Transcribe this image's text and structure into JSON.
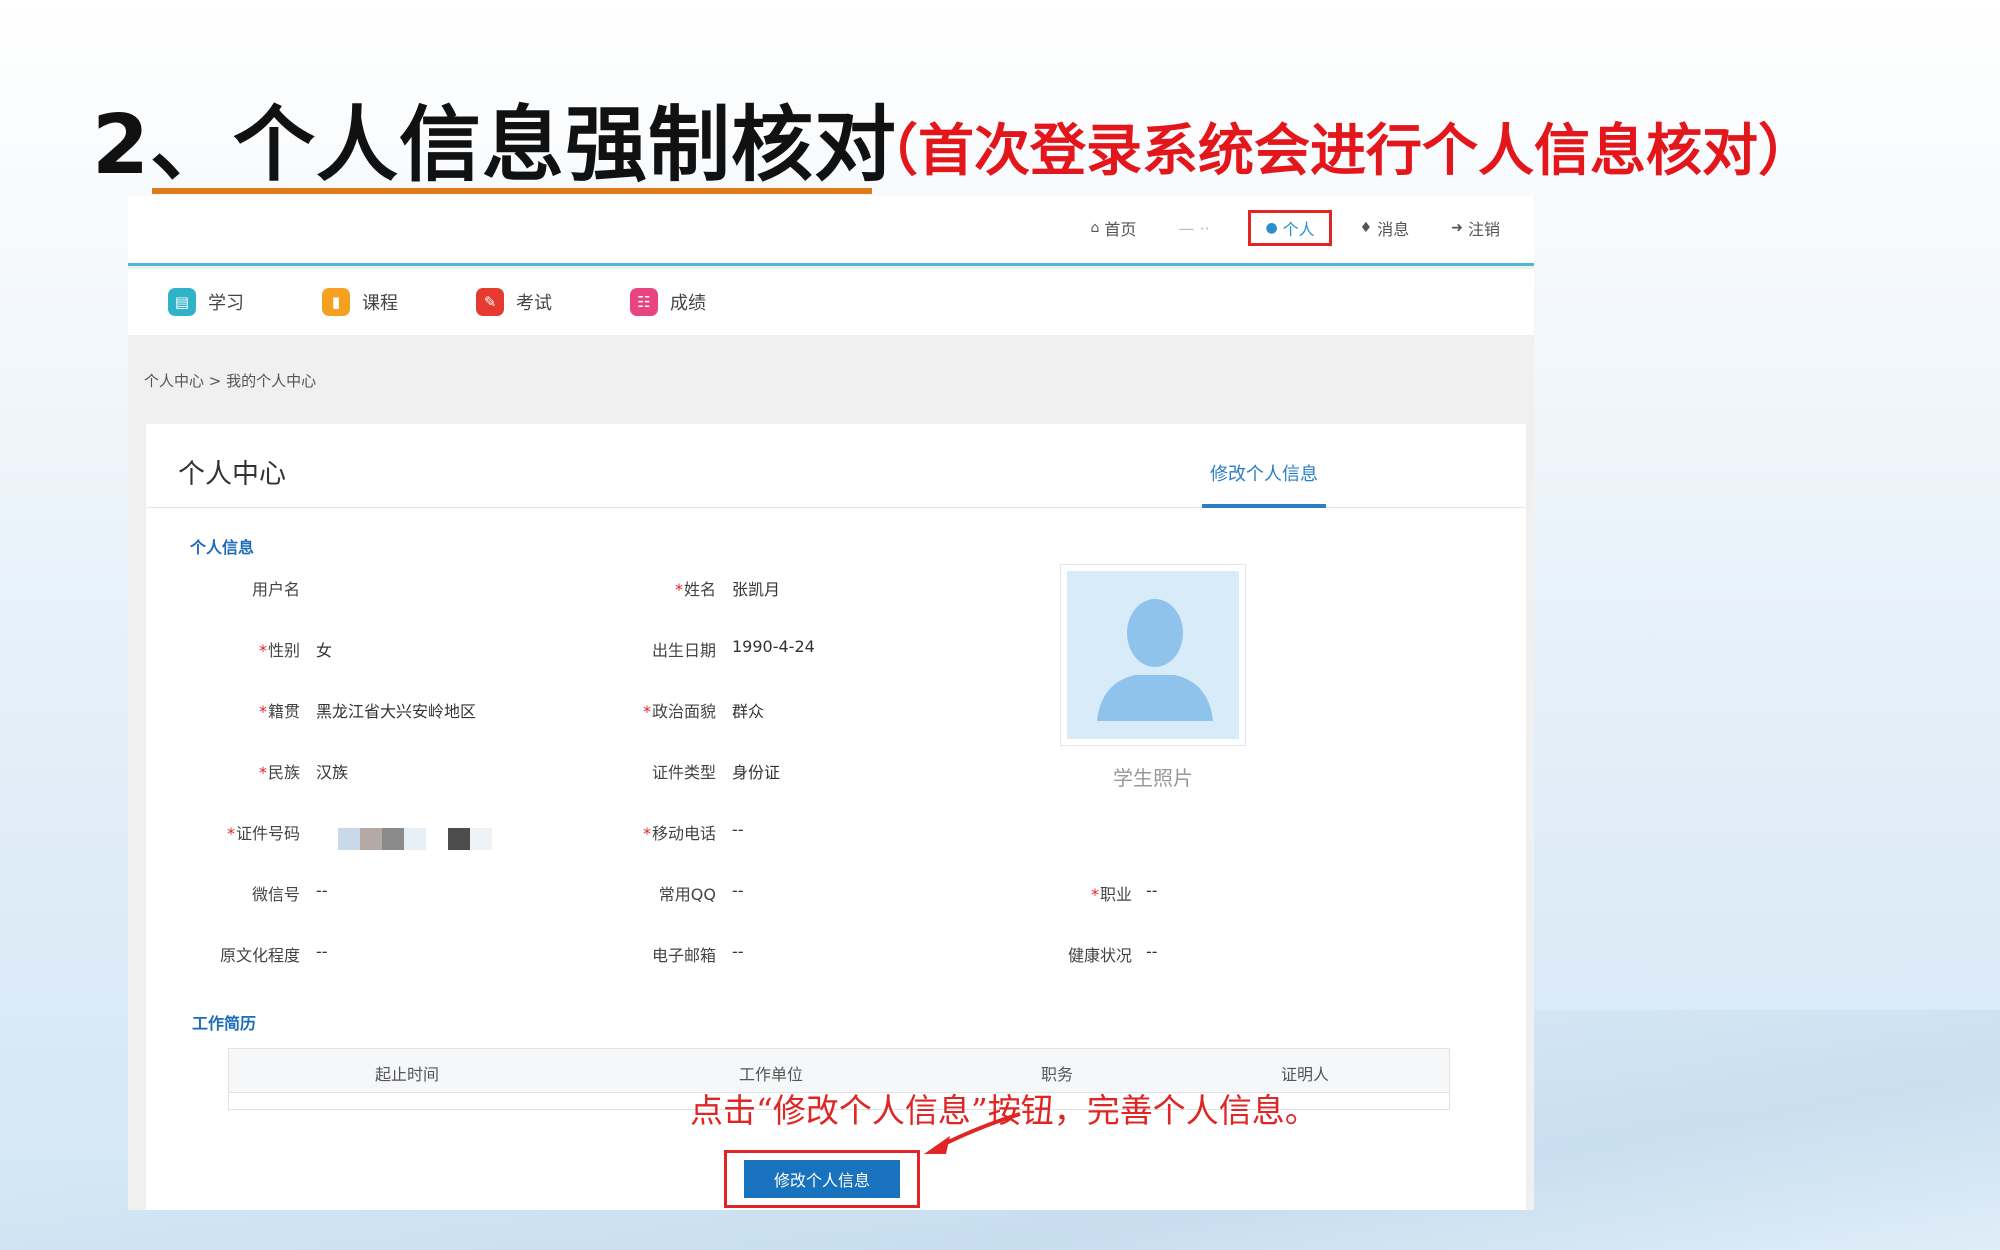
{
  "slide": {
    "title": "2、个人信息强制核对",
    "subtitle": "（首次登录系统会进行个人信息核对）",
    "instruction": "点击“修改个人信息”按钮，完善个人信息。"
  },
  "topbar": {
    "links": [
      {
        "label": "首页",
        "icon": "home-icon"
      },
      {
        "label": "个人",
        "icon": "user-icon",
        "active": true
      },
      {
        "label": "消息",
        "icon": "bell-icon"
      },
      {
        "label": "注销",
        "icon": "logout-icon"
      }
    ]
  },
  "nav": {
    "items": [
      {
        "label": "学习",
        "icon": "study-icon",
        "color": "#2fb3c9"
      },
      {
        "label": "课程",
        "icon": "course-icon",
        "color": "#f5a020"
      },
      {
        "label": "考试",
        "icon": "exam-icon",
        "color": "#e53a2f"
      },
      {
        "label": "成绩",
        "icon": "grade-icon",
        "color": "#e8447f"
      }
    ]
  },
  "breadcrumb": "个人中心 > 我的个人中心",
  "card": {
    "title": "个人中心",
    "tab_label": "修改个人信息",
    "section_personal": "个人信息",
    "section_work": "工作简历",
    "photo_caption": "学生照片"
  },
  "fields": {
    "username": {
      "label": "用户名",
      "value": ""
    },
    "name": {
      "label": "姓名",
      "value": "张凯月"
    },
    "gender": {
      "label": "性别",
      "value": "女"
    },
    "birthdate": {
      "label": "出生日期",
      "value": "1990-4-24"
    },
    "native_place": {
      "label": "籍贯",
      "value": "黑龙江省大兴安岭地区"
    },
    "political": {
      "label": "政治面貌",
      "value": "群众"
    },
    "ethnicity": {
      "label": "民族",
      "value": "汉族"
    },
    "id_type": {
      "label": "证件类型",
      "value": "身份证"
    },
    "id_number": {
      "label": "证件号码",
      "value": ""
    },
    "mobile": {
      "label": "移动电话",
      "value": "--"
    },
    "wechat": {
      "label": "微信号",
      "value": "--"
    },
    "qq": {
      "label": "常用QQ",
      "value": "--"
    },
    "occupation": {
      "label": "职业",
      "value": "--"
    },
    "education": {
      "label": "原文化程度",
      "value": "--"
    },
    "email": {
      "label": "电子邮箱",
      "value": "--"
    },
    "health": {
      "label": "健康状况",
      "value": "--"
    }
  },
  "work_table": {
    "headers": [
      "起止时间",
      "工作单位",
      "职务",
      "证明人"
    ]
  },
  "button": {
    "label": "修改个人信息"
  },
  "colors": {
    "accent_blue": "#1872bd",
    "highlight_red": "#e02525",
    "title_underline": "#e07a1f",
    "topbar_border": "#4fb7d6"
  }
}
